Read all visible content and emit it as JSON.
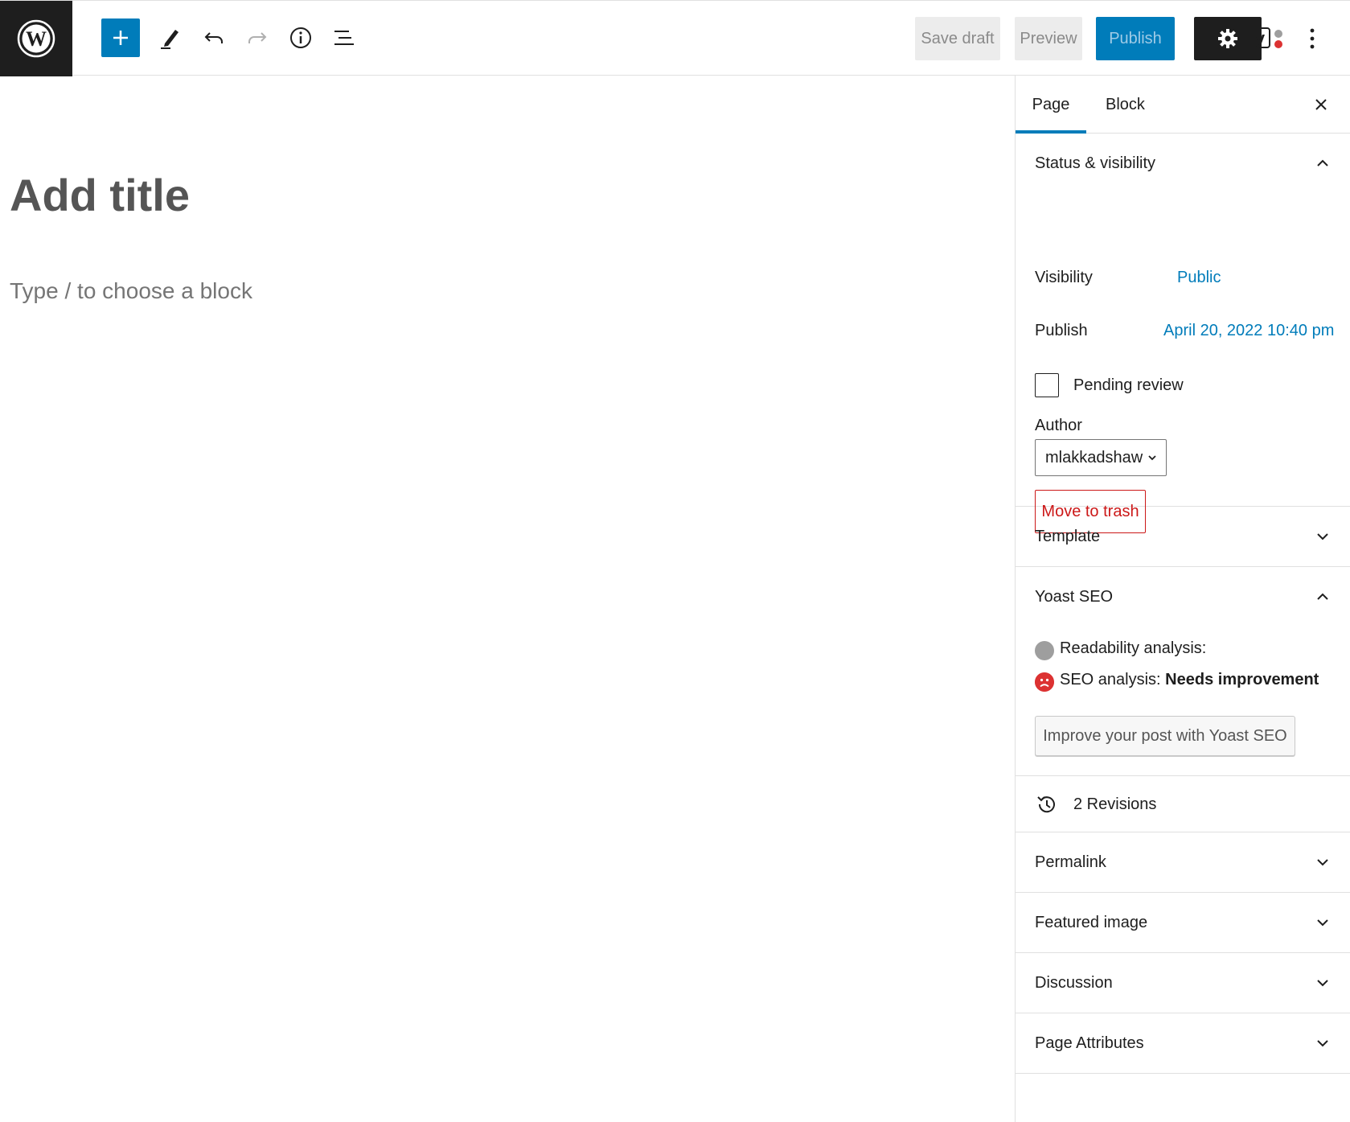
{
  "toolbar": {
    "save_draft_label": "Save draft",
    "preview_label": "Preview",
    "publish_label": "Publish"
  },
  "editor": {
    "title_placeholder": "Add title",
    "block_placeholder": "Type / to choose a block"
  },
  "sidebar": {
    "tabs": [
      {
        "label": "Page",
        "active": true
      },
      {
        "label": "Block",
        "active": false
      }
    ],
    "status_visibility": {
      "heading": "Status & visibility",
      "visibility_label": "Visibility",
      "visibility_value": "Public",
      "publish_label": "Publish",
      "publish_value": "April 20, 2022 10:40 pm",
      "pending_review_label": "Pending review",
      "author_label": "Author",
      "author_value": "mlakkadshaw",
      "trash_label": "Move to trash"
    },
    "template": {
      "heading": "Template"
    },
    "yoast": {
      "heading": "Yoast SEO",
      "readability_label": "Readability analysis:",
      "seo_label": "SEO analysis:",
      "seo_status": "Needs improvement",
      "improve_button": "Improve your post with Yoast SEO"
    },
    "revisions": {
      "label": "2 Revisions"
    },
    "permalink": {
      "heading": "Permalink"
    },
    "featured_image": {
      "heading": "Featured image"
    },
    "discussion": {
      "heading": "Discussion"
    },
    "page_attributes": {
      "heading": "Page Attributes"
    }
  },
  "colors": {
    "accent": "#007cba",
    "danger": "#cc1818",
    "seo_bad": "#dc3232",
    "neutral_dot": "#9e9e9e",
    "dark": "#1e1e1e"
  },
  "icons": [
    "wordpress-logo-icon",
    "plus-icon",
    "pencil-icon",
    "undo-icon",
    "redo-icon",
    "info-icon",
    "list-view-icon",
    "gear-icon",
    "yoast-icon",
    "more-vertical-icon",
    "close-icon",
    "chevron-up-icon",
    "chevron-down-icon",
    "history-icon",
    "sad-face-icon"
  ]
}
